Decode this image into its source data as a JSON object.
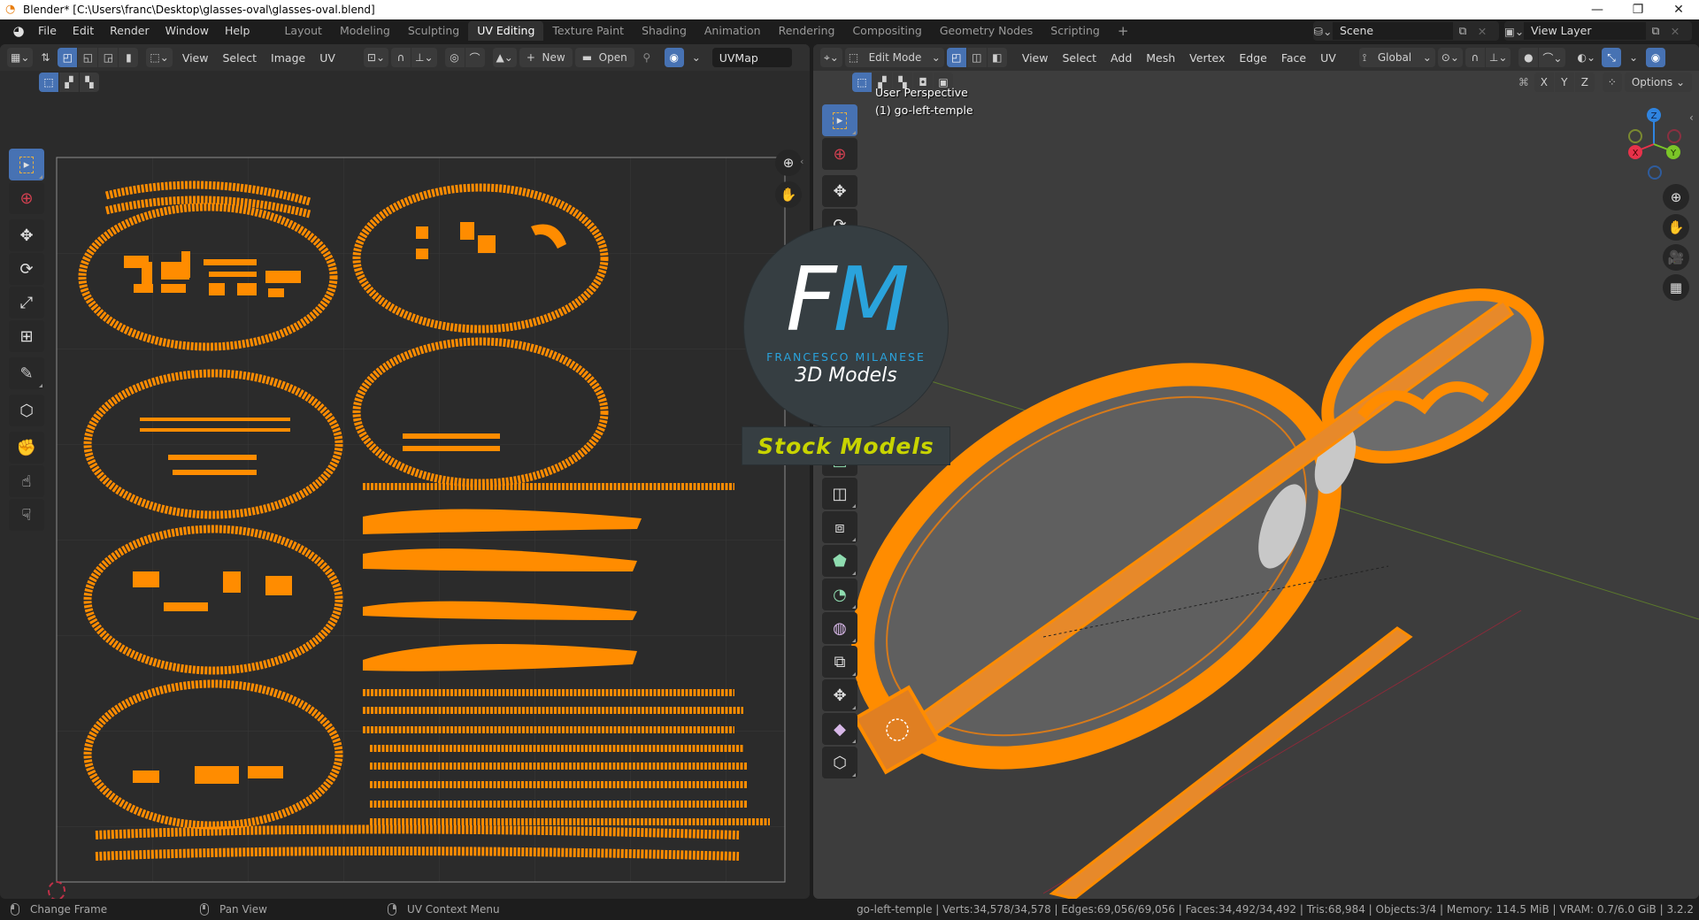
{
  "window": {
    "title": "Blender* [C:\\Users\\franc\\Desktop\\glasses-oval\\glasses-oval.blend]",
    "controls": {
      "minimize": "—",
      "maximize": "❐",
      "close": "✕"
    }
  },
  "topbar": {
    "menus": [
      "File",
      "Edit",
      "Render",
      "Window",
      "Help"
    ],
    "workspaces": [
      {
        "label": "Layout",
        "active": false
      },
      {
        "label": "Modeling",
        "active": false
      },
      {
        "label": "Sculpting",
        "active": false
      },
      {
        "label": "UV Editing",
        "active": true
      },
      {
        "label": "Texture Paint",
        "active": false
      },
      {
        "label": "Shading",
        "active": false
      },
      {
        "label": "Animation",
        "active": false
      },
      {
        "label": "Rendering",
        "active": false
      },
      {
        "label": "Compositing",
        "active": false
      },
      {
        "label": "Geometry Nodes",
        "active": false
      },
      {
        "label": "Scripting",
        "active": false
      }
    ],
    "add_workspace": "+",
    "scene": "Scene",
    "view_layer": "View Layer"
  },
  "uv_editor": {
    "menus": [
      "View",
      "Select",
      "Image",
      "UV"
    ],
    "new_label": "New",
    "open_label": "Open",
    "uvmap": "UVMap"
  },
  "viewport": {
    "mode": "Edit Mode",
    "menus": [
      "View",
      "Select",
      "Add",
      "Mesh",
      "Vertex",
      "Edge",
      "Face",
      "UV"
    ],
    "orientation": "Global",
    "axes": [
      "X",
      "Y",
      "Z"
    ],
    "options_label": "Options",
    "overlay_line1": "User Perspective",
    "overlay_line2": "(1) go-left-temple",
    "gizmo": {
      "x": "X",
      "y": "Y",
      "z": "Z"
    }
  },
  "watermark": {
    "f": "F",
    "m": "M",
    "name": "FRANCESCO MILANESE",
    "subtitle": "3D Models",
    "banner": "Stock Models"
  },
  "statusbar": {
    "hints": [
      "Change Frame",
      "Pan View",
      "UV Context Menu"
    ],
    "stats": "go-left-temple | Verts:34,578/34,578 | Edges:69,056/69,056 | Faces:34,492/34,492 | Tris:68,984 | Objects:3/4 | Memory: 114.5 MiB | VRAM: 0.7/6.0 GiB | 3.2.2"
  },
  "colors": {
    "accent_blue": "#4772b3",
    "selection_orange": "#ff8c00",
    "axis_x": "#e8324a",
    "axis_y": "#7bc628",
    "axis_z": "#2f84e0"
  }
}
